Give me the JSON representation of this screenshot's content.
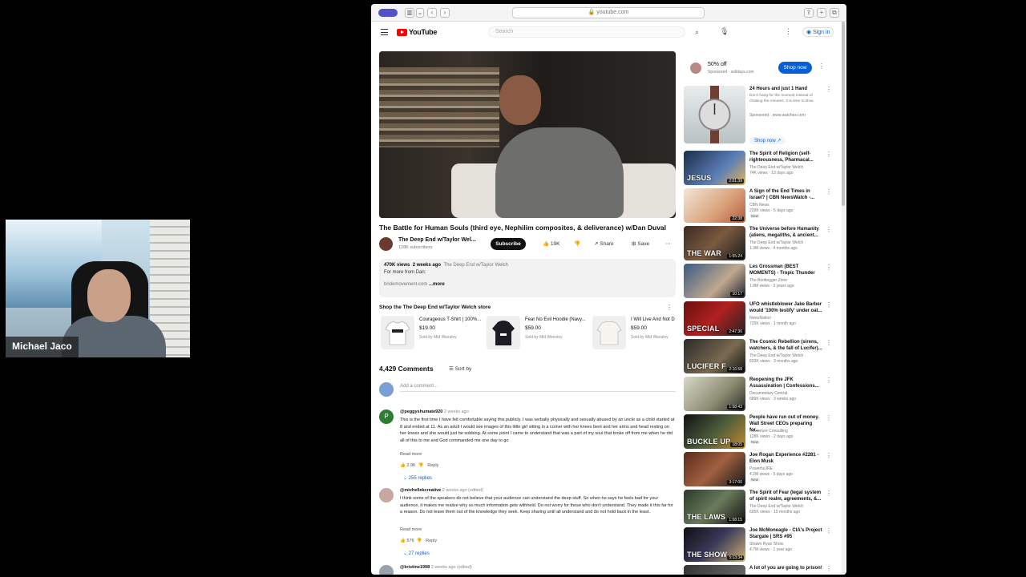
{
  "webcam": {
    "name": "Michael Jaco"
  },
  "browser": {
    "url": "youtube.com"
  },
  "header": {
    "logo": "YouTube",
    "search_placeholder": "Search",
    "sign_in": "Sign in"
  },
  "video": {
    "title": "The Battle for Human Souls (third eye, Nephilim composites, & deliverance) w/Dan Duval",
    "channel": "The Deep End w/Taylor Wel...",
    "subscribers": "128K subscribers",
    "subscribe": "Subscribe",
    "likes": "19K",
    "share": "Share",
    "save": "Save",
    "views": "470K views",
    "age": "2 weeks ago",
    "desc_channel": "The Deep End w/Taylor Welch",
    "desc_line": "For more from Dan:",
    "desc_link": "bridemovement.com",
    "desc_more": "...more"
  },
  "shop": {
    "heading": "Shop the The Deep End w/Taylor Welch store",
    "items": [
      {
        "name": "Courageous T-Shirt | 100%...",
        "price": "$19.00",
        "seller": "Sold by Mid Weesley"
      },
      {
        "name": "Fear No Evil Hoodie (Navy...",
        "price": "$59.00",
        "seller": "Sold by Mid Weesley"
      },
      {
        "name": "I Will Live And Not D",
        "price": "$59.00",
        "seller": "Sold by Mid Weesley"
      }
    ]
  },
  "comments": {
    "count": "4,429 Comments",
    "sort": "Sort by",
    "add_placeholder": "Add a comment...",
    "items": [
      {
        "initial": "P",
        "author": "@peggyshumate920",
        "age": "2 weeks ago",
        "text": "This is the first time I have felt comfortable saying this publicly. I was verbally physically and sexually abused by an uncle as a child started at 8 and ended at 11. As an adult I would see images of this little girl sitting in a corner with her knees bent and her arms and head resting on her knees and she would just be sobbing. At some point I came to understand that was a part of my soul that broke off from me when he did all of this to me and God commanded me one day to go",
        "read_more": "Read more",
        "likes": "2.9K",
        "reply": "Reply",
        "replies": "255 replies"
      },
      {
        "initial": "",
        "author": "@michellekcreative",
        "age": "2 weeks ago (edited)",
        "text": "I think some of the speakers do not believe that your audience can understand the deep stuff.  So when he says he feels bad for your audience, it makes me realize why so much information gets withheld. Do not worry for those who don't understand. They made it this far for a reason.  Do not leave them out of the knowledge they seek. Keep sharing until all understand  and do not hold back in the least.",
        "read_more": "Read more",
        "likes": "576",
        "reply": "Reply",
        "replies": "27 replies"
      },
      {
        "initial": "",
        "author": "@kristine1998",
        "age": "2 weeks ago (edited)",
        "text": "",
        "read_more": "",
        "likes": "",
        "reply": "",
        "replies": ""
      }
    ]
  },
  "ad": {
    "title": "50% off",
    "sponsor": "Sponsored · solidays.com",
    "button": "Shop now"
  },
  "recommendations": [
    {
      "title": "24 Hours and just 1 Hand",
      "channel": "Don't hang for the moment instead of chasing the minutes. It is time to slow.",
      "meta": "Sponsored · www.watches.com",
      "overlay": "",
      "duration": "",
      "cta": "Shop now",
      "new": ""
    },
    {
      "title": "The Spirit of Religion (self-righteousness, Pharmacal...",
      "channel": "The Deep End w/Taylor Welch",
      "meta": "74K views · 13 days ago",
      "overlay": "JESUS",
      "duration": "2:01:39",
      "cta": "",
      "new": ""
    },
    {
      "title": "A Sign of the End Times in Israel? | CBN NewsWatch -...",
      "channel": "CBN News",
      "meta": "229K views · 5 days ago",
      "overlay": "",
      "duration": "22:38",
      "cta": "",
      "new": "New"
    },
    {
      "title": "The Universe before Humanity (aliens, megaliths, & ancient...",
      "channel": "The Deep End w/Taylor Welch",
      "meta": "1.3M views · 4 months ago",
      "overlay": "THE WAR",
      "duration": "1:55:24",
      "cta": "",
      "new": ""
    },
    {
      "title": "Les Grossman (BEST MOMENTS) - Tropic Thunder",
      "channel": "The Bootlegger Zone",
      "meta": "1.8M views · 3 years ago",
      "overlay": "",
      "duration": "10:17",
      "cta": "",
      "new": ""
    },
    {
      "title": "UFO whistleblower Jake Barber would '100% testify' under oat...",
      "channel": "NewsNation",
      "meta": "725K views · 1 month ago",
      "overlay": "SPECIAL",
      "duration": "2:47:36",
      "cta": "",
      "new": ""
    },
    {
      "title": "The Cosmic Rebellion (sirens, watchers, & the fall of Lucifer)...",
      "channel": "The Deep End w/Taylor Welch",
      "meta": "833K views · 3 months ago",
      "overlay": "LUCIFER F",
      "duration": "2:16:58",
      "cta": "",
      "new": ""
    },
    {
      "title": "Reopening the JFK Assassination | Confessions...",
      "channel": "Documentary Central",
      "meta": "689K views · 3 weeks ago",
      "overlay": "",
      "duration": "1:58:43",
      "cta": "",
      "new": ""
    },
    {
      "title": "People have run out of money. Wall Street CEOs preparing for...",
      "channel": "Adventure Consulting",
      "meta": "128K views · 2 days ago",
      "overlay": "BUCKLE UP",
      "duration": "18:05",
      "cta": "",
      "new": "New"
    },
    {
      "title": "Joe Rogan Experience #2281 - Elon Musk",
      "channel": "PowerfulJRE",
      "meta": "4.2M views · 5 days ago",
      "overlay": "",
      "duration": "3:17:00",
      "cta": "",
      "new": "New"
    },
    {
      "title": "The Spirit of Fear (legal system of spirit realm, agreements, &...",
      "channel": "The Deep End w/Taylor Welch",
      "meta": "605K views · 10 months ago",
      "overlay": "THE LAWS",
      "duration": "1:58:15",
      "cta": "",
      "new": ""
    },
    {
      "title": "Joe McMoneagle - CIA's Project Stargate | SRS #95",
      "channel": "Shawn Ryan Show",
      "meta": "4.7M views · 1 year ago",
      "overlay": "THE SHOW",
      "duration": "5:13:34",
      "cta": "",
      "new": ""
    },
    {
      "title": "A lot of you are going to prison!",
      "channel": "",
      "meta": "",
      "overlay": "",
      "duration": "",
      "cta": "",
      "new": ""
    }
  ]
}
